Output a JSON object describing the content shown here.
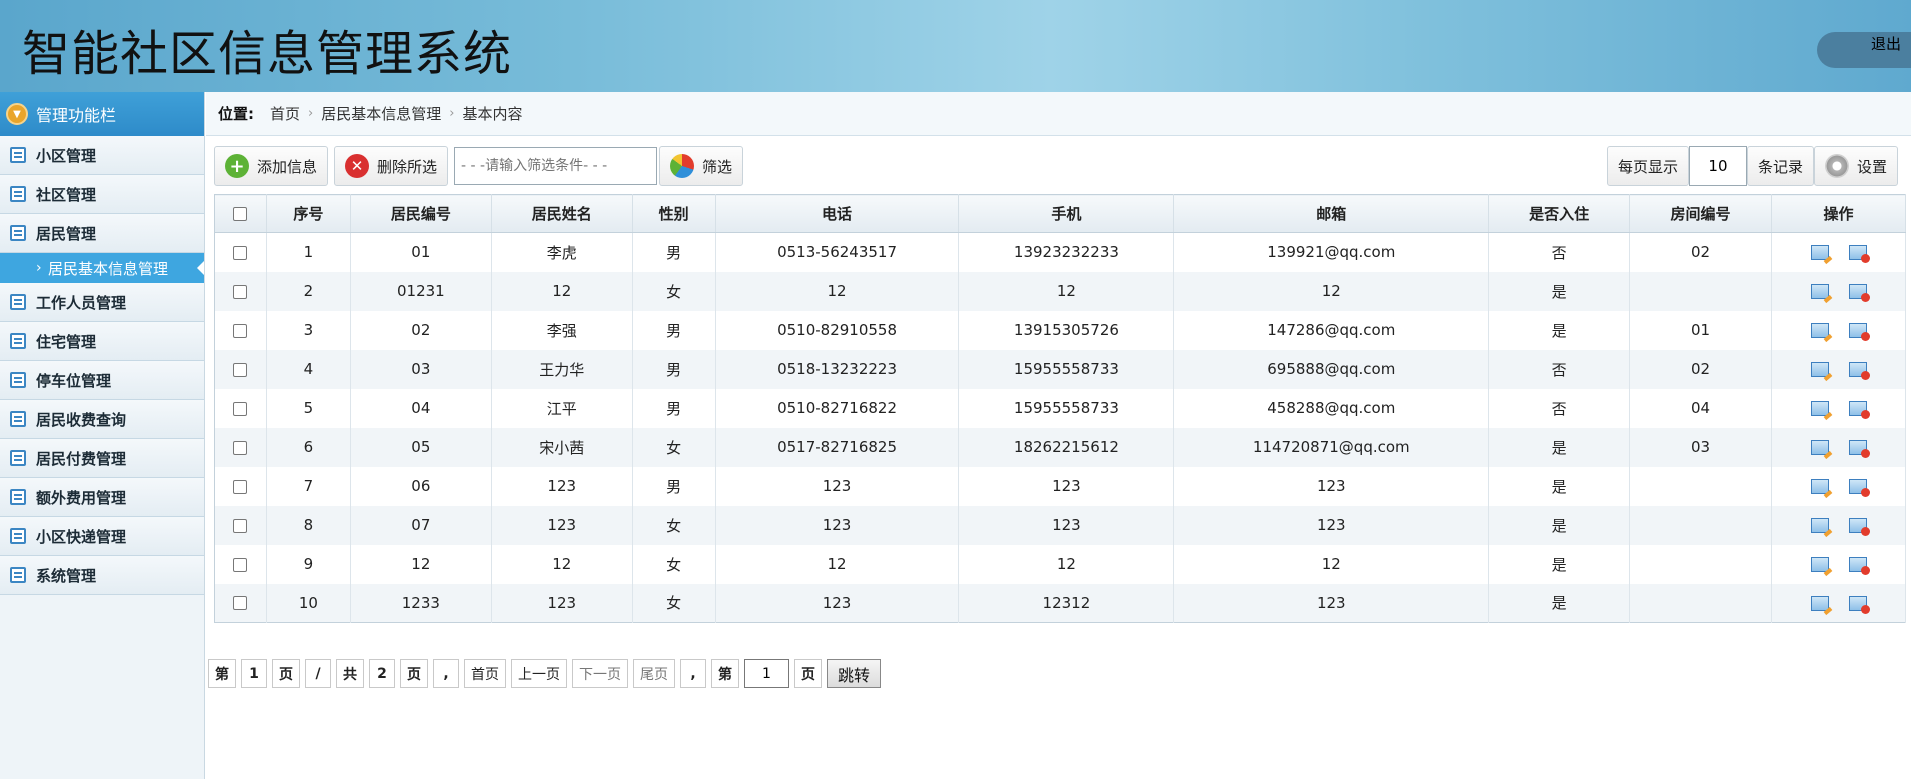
{
  "header": {
    "title": "智能社区信息管理系统",
    "logout": "退出"
  },
  "sidebar": {
    "title": "管理功能栏",
    "items": [
      {
        "label": "小区管理",
        "icon": "list-icon"
      },
      {
        "label": "社区管理",
        "icon": "chat-icon"
      },
      {
        "label": "居民管理",
        "icon": "edit-icon"
      },
      {
        "label": "工作人员管理",
        "icon": "calendar-icon"
      },
      {
        "label": "住宅管理",
        "icon": "calendar-icon"
      },
      {
        "label": "停车位管理",
        "icon": "calendar-icon"
      },
      {
        "label": "居民收费查询",
        "icon": "calendar-icon"
      },
      {
        "label": "居民付费管理",
        "icon": "calendar-icon"
      },
      {
        "label": "额外费用管理",
        "icon": "calendar-icon"
      },
      {
        "label": "小区快递管理",
        "icon": "calendar-icon"
      },
      {
        "label": "系统管理",
        "icon": "calendar-icon"
      }
    ],
    "active_sub": "居民基本信息管理"
  },
  "breadcrumb": {
    "label": "位置:",
    "items": [
      "首页",
      "居民基本信息管理",
      "基本内容"
    ]
  },
  "toolbar": {
    "add": "添加信息",
    "delete": "删除所选",
    "filter_placeholder": "- - -请输入筛选条件- - -",
    "filter": "筛选",
    "per_page_label": "每页显示",
    "per_page_value": "10",
    "records_label": "条记录",
    "settings": "设置"
  },
  "table": {
    "headers": [
      "序号",
      "居民编号",
      "居民姓名",
      "性别",
      "电话",
      "手机",
      "邮箱",
      "是否入住",
      "房间编号",
      "操作"
    ],
    "rows": [
      [
        "1",
        "01",
        "李虎",
        "男",
        "0513-56243517",
        "13923232233",
        "139921@qq.com",
        "否",
        "02"
      ],
      [
        "2",
        "01231",
        "12",
        "女",
        "12",
        "12",
        "12",
        "是",
        ""
      ],
      [
        "3",
        "02",
        "李强",
        "男",
        "0510-82910558",
        "13915305726",
        "147286@qq.com",
        "是",
        "01"
      ],
      [
        "4",
        "03",
        "王力华",
        "男",
        "0518-13232223",
        "15955558733",
        "695888@qq.com",
        "否",
        "02"
      ],
      [
        "5",
        "04",
        "江平",
        "男",
        "0510-82716822",
        "15955558733",
        "458288@qq.com",
        "否",
        "04"
      ],
      [
        "6",
        "05",
        "宋小茜",
        "女",
        "0517-82716825",
        "18262215612",
        "114720871@qq.com",
        "是",
        "03"
      ],
      [
        "7",
        "06",
        "123",
        "男",
        "123",
        "123",
        "123",
        "是",
        ""
      ],
      [
        "8",
        "07",
        "123",
        "女",
        "123",
        "123",
        "123",
        "是",
        ""
      ],
      [
        "9",
        "12",
        "12",
        "女",
        "12",
        "12",
        "12",
        "是",
        ""
      ],
      [
        "10",
        "1233",
        "123",
        "女",
        "123",
        "12312",
        "123",
        "是",
        ""
      ]
    ]
  },
  "pagination": {
    "prefix": "第",
    "current": "1",
    "page_unit": "页",
    "slash": "/",
    "total_prefix": "共",
    "total": "2",
    "comma": ",",
    "first": "首页",
    "prev": "上一页",
    "next": "下一页",
    "last": "尾页",
    "goto_value": "1",
    "jump": "跳转"
  }
}
